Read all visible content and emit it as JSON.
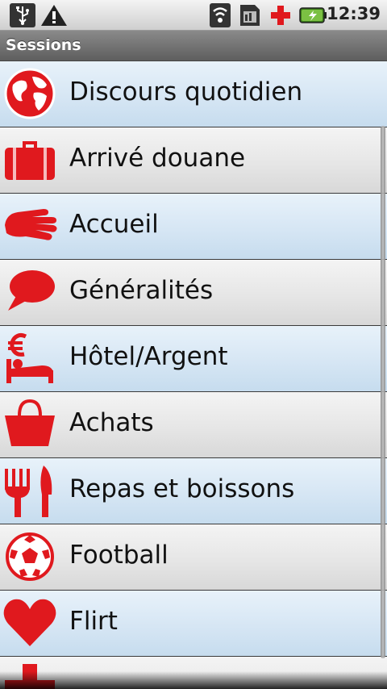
{
  "status_bar": {
    "time": "12:39",
    "icons": [
      "usb-icon",
      "warning-icon",
      "wifi-icon",
      "sim-card-icon",
      "medical-cross-icon",
      "battery-charging-icon"
    ]
  },
  "title_bar": {
    "title": "Sessions"
  },
  "colors": {
    "icon_red": "#e0191e",
    "row_blue": "#d6e6f4",
    "row_grey": "#e6e6e6"
  },
  "sessions": [
    {
      "label": "Discours quotidien",
      "icon": "globe-icon"
    },
    {
      "label": "Arrivé douane",
      "icon": "suitcase-icon"
    },
    {
      "label": "Accueil",
      "icon": "hand-icon"
    },
    {
      "label": "Généralités",
      "icon": "speech-bubble-icon"
    },
    {
      "label": "Hôtel/Argent",
      "icon": "hotel-euro-icon"
    },
    {
      "label": "Achats",
      "icon": "shopping-basket-icon"
    },
    {
      "label": "Repas et boissons",
      "icon": "fork-knife-icon"
    },
    {
      "label": "Football",
      "icon": "soccer-ball-icon"
    },
    {
      "label": "Flirt",
      "icon": "heart-icon"
    },
    {
      "label": "",
      "icon": "medical-cross-icon"
    }
  ]
}
